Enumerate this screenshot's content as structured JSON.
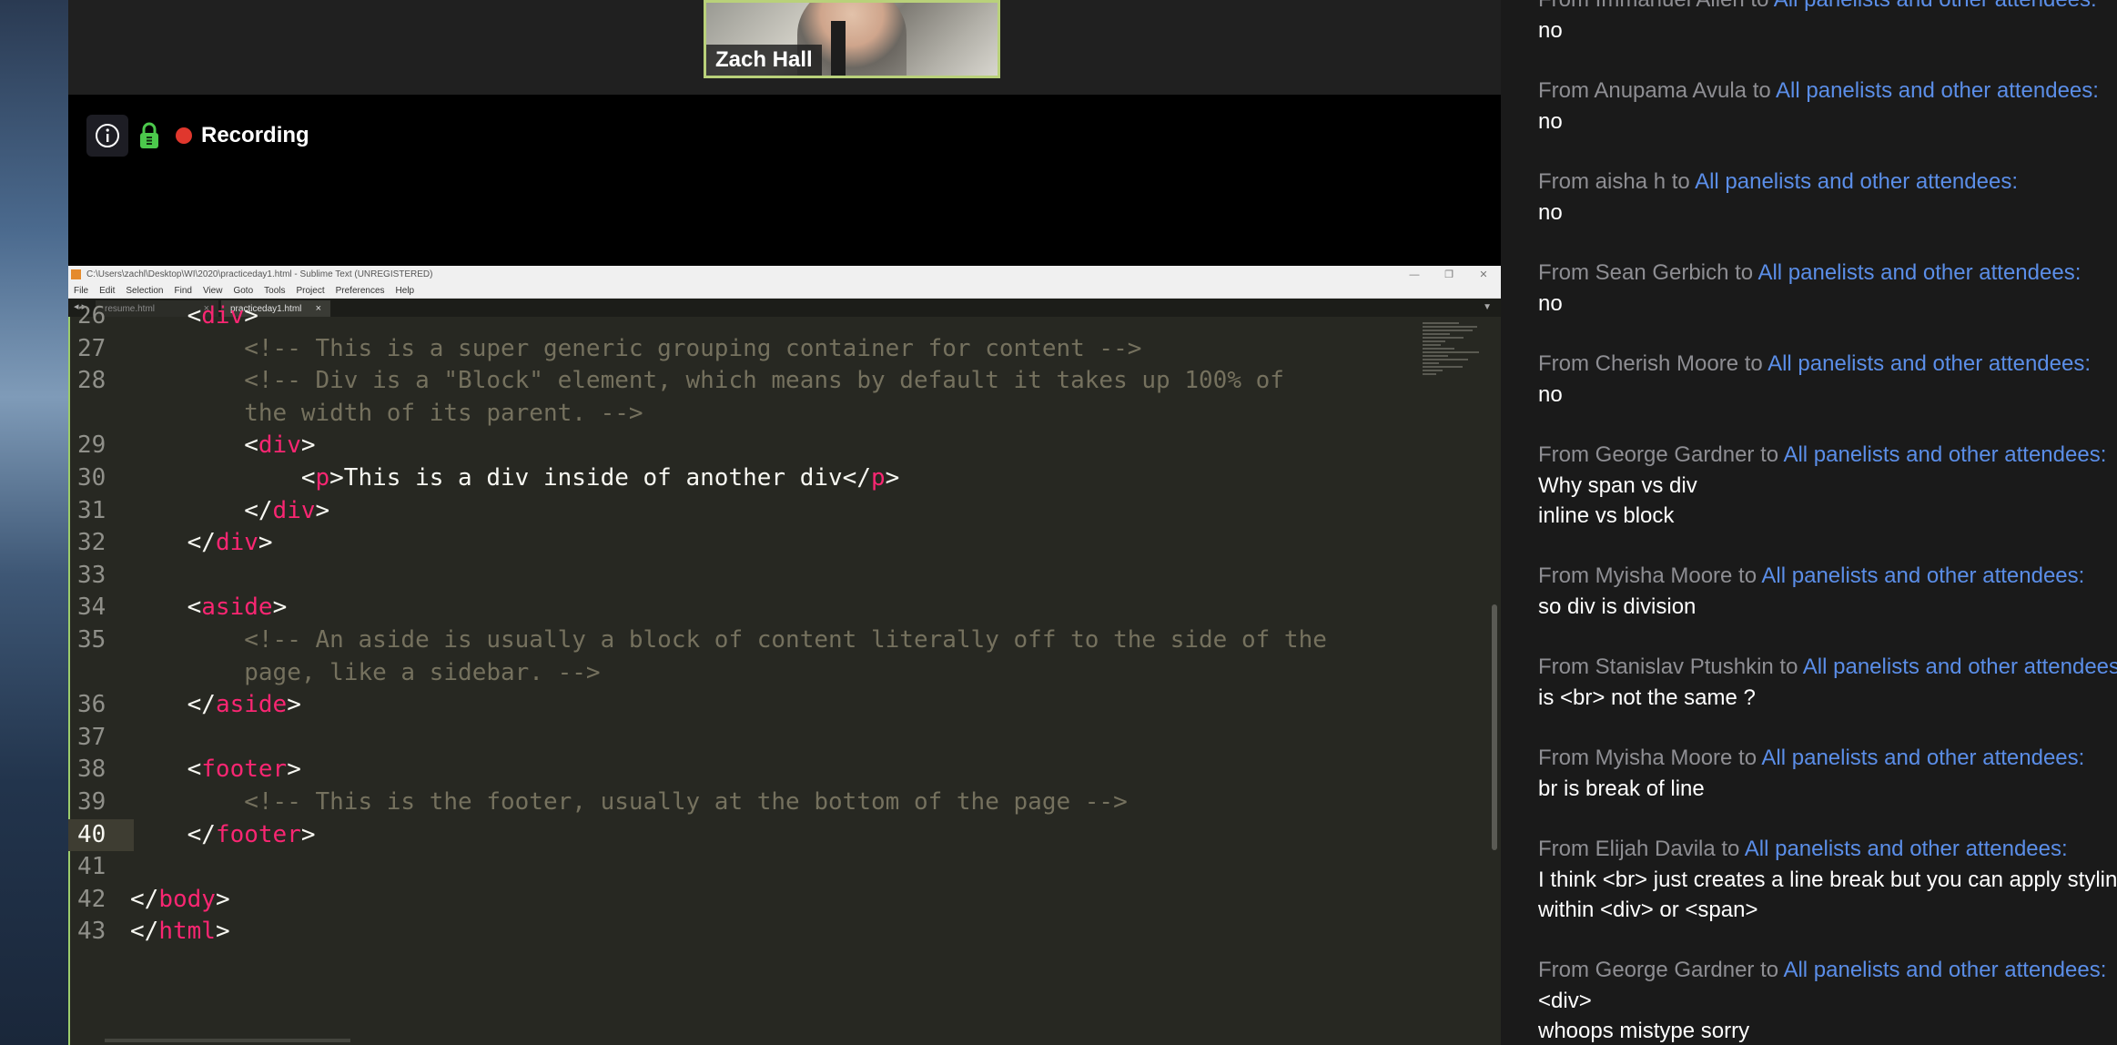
{
  "zoom": {
    "participant_name": "Zach Hall",
    "recording_label": "Recording"
  },
  "sublime": {
    "title": "C:\\Users\\zachl\\Desktop\\WI\\2020\\practiceday1.html - Sublime Text (UNREGISTERED)",
    "menu": [
      "File",
      "Edit",
      "Selection",
      "Find",
      "View",
      "Goto",
      "Tools",
      "Project",
      "Preferences",
      "Help"
    ],
    "tabs": [
      {
        "label": "resume.html"
      },
      {
        "label": "practiceday1.html"
      }
    ],
    "current_line": "40",
    "lines": [
      {
        "num": "26",
        "indent": "    ",
        "parts": [
          {
            "t": "br",
            "v": "<"
          },
          {
            "t": "tag",
            "v": "div"
          },
          {
            "t": "br",
            "v": ">"
          }
        ]
      },
      {
        "num": "27",
        "indent": "        ",
        "parts": [
          {
            "t": "cmt",
            "v": "<!-- This is a super generic grouping container for content -->"
          }
        ]
      },
      {
        "num": "28",
        "indent": "        ",
        "parts": [
          {
            "t": "cmt",
            "v": "<!-- Div is a \"Block\" element, which means by default it takes up 100% of"
          }
        ]
      },
      {
        "num": "",
        "indent": "        ",
        "parts": [
          {
            "t": "cmt",
            "v": "the width of its parent. -->"
          }
        ]
      },
      {
        "num": "29",
        "indent": "        ",
        "parts": [
          {
            "t": "br",
            "v": "<"
          },
          {
            "t": "tag",
            "v": "div"
          },
          {
            "t": "br",
            "v": ">"
          }
        ]
      },
      {
        "num": "30",
        "indent": "            ",
        "parts": [
          {
            "t": "br",
            "v": "<"
          },
          {
            "t": "tag",
            "v": "p"
          },
          {
            "t": "br",
            "v": ">This is a div inside of another div</"
          },
          {
            "t": "tag",
            "v": "p"
          },
          {
            "t": "br",
            "v": ">"
          }
        ]
      },
      {
        "num": "31",
        "indent": "        ",
        "parts": [
          {
            "t": "br",
            "v": "</"
          },
          {
            "t": "tag",
            "v": "div"
          },
          {
            "t": "br",
            "v": ">"
          }
        ]
      },
      {
        "num": "32",
        "indent": "    ",
        "parts": [
          {
            "t": "br",
            "v": "</"
          },
          {
            "t": "tag",
            "v": "div"
          },
          {
            "t": "br",
            "v": ">"
          }
        ]
      },
      {
        "num": "33",
        "indent": "",
        "parts": []
      },
      {
        "num": "34",
        "indent": "    ",
        "parts": [
          {
            "t": "br",
            "v": "<"
          },
          {
            "t": "tag",
            "v": "aside"
          },
          {
            "t": "br",
            "v": ">"
          }
        ]
      },
      {
        "num": "35",
        "indent": "        ",
        "parts": [
          {
            "t": "cmt",
            "v": "<!-- An aside is usually a block of content literally off to the side of the"
          }
        ]
      },
      {
        "num": "",
        "indent": "        ",
        "parts": [
          {
            "t": "cmt",
            "v": "page, like a sidebar. -->"
          }
        ]
      },
      {
        "num": "36",
        "indent": "    ",
        "parts": [
          {
            "t": "br",
            "v": "</"
          },
          {
            "t": "tag",
            "v": "aside"
          },
          {
            "t": "br",
            "v": ">"
          }
        ]
      },
      {
        "num": "37",
        "indent": "",
        "parts": []
      },
      {
        "num": "38",
        "indent": "    ",
        "parts": [
          {
            "t": "br",
            "v": "<"
          },
          {
            "t": "tag",
            "v": "footer"
          },
          {
            "t": "br",
            "v": ">"
          }
        ]
      },
      {
        "num": "39",
        "indent": "        ",
        "parts": [
          {
            "t": "cmt",
            "v": "<!-- This is the footer, usually at the bottom of the page -->"
          }
        ]
      },
      {
        "num": "40",
        "indent": "    ",
        "parts": [
          {
            "t": "br",
            "v": "</"
          },
          {
            "t": "tag",
            "v": "footer"
          },
          {
            "t": "br",
            "v": ">"
          }
        ]
      },
      {
        "num": "41",
        "indent": "",
        "parts": []
      },
      {
        "num": "42",
        "indent": "",
        "parts": [
          {
            "t": "br",
            "v": "</"
          },
          {
            "t": "tag",
            "v": "body"
          },
          {
            "t": "br",
            "v": ">"
          }
        ]
      },
      {
        "num": "43",
        "indent": "",
        "parts": [
          {
            "t": "br",
            "v": "</"
          },
          {
            "t": "tag",
            "v": "html"
          },
          {
            "t": "br",
            "v": ">"
          }
        ]
      }
    ]
  },
  "chat": {
    "messages": [
      {
        "from": "From Immanuel Allen to ",
        "to": "All panelists and other attendees:",
        "body": [
          "no"
        ]
      },
      {
        "from": "From Anupama Avula to ",
        "to": "All panelists and other attendees:",
        "body": [
          "no"
        ]
      },
      {
        "from": "From aisha h to ",
        "to": "All panelists and other attendees:",
        "body": [
          "no"
        ]
      },
      {
        "from": "From Sean Gerbich to ",
        "to": "All panelists and other attendees:",
        "body": [
          "no"
        ]
      },
      {
        "from": "From Cherish Moore to ",
        "to": "All panelists and other attendees:",
        "body": [
          "no"
        ]
      },
      {
        "from": "From George Gardner to ",
        "to": "All panelists and other attendees:",
        "body": [
          "Why span vs div",
          "inline vs block"
        ]
      },
      {
        "from": "From Myisha Moore to ",
        "to": "All panelists and other attendees:",
        "body": [
          "so div is division"
        ]
      },
      {
        "from": "From Stanislav Ptushkin to ",
        "to": "All panelists and other attendees:",
        "body": [
          "is <br> not the same ?"
        ]
      },
      {
        "from": "From Myisha Moore to ",
        "to": "All panelists and other attendees:",
        "body": [
          "br is break of line"
        ]
      },
      {
        "from": "From Elijah Davila to ",
        "to": "All panelists and other attendees:",
        "body": [
          "I think <br> just creates a line break but you can apply styling",
          "within <div> or <span>"
        ]
      },
      {
        "from": "From George Gardner to ",
        "to": "All panelists and other attendees:",
        "body": [
          "<div>",
          "whoops mistype sorry"
        ]
      }
    ]
  },
  "colors": {
    "editor_bg": "#272822",
    "tag": "#f92672",
    "comment": "#75715e",
    "chat_link": "#5b8ee8",
    "recording_dot": "#e0372d"
  }
}
